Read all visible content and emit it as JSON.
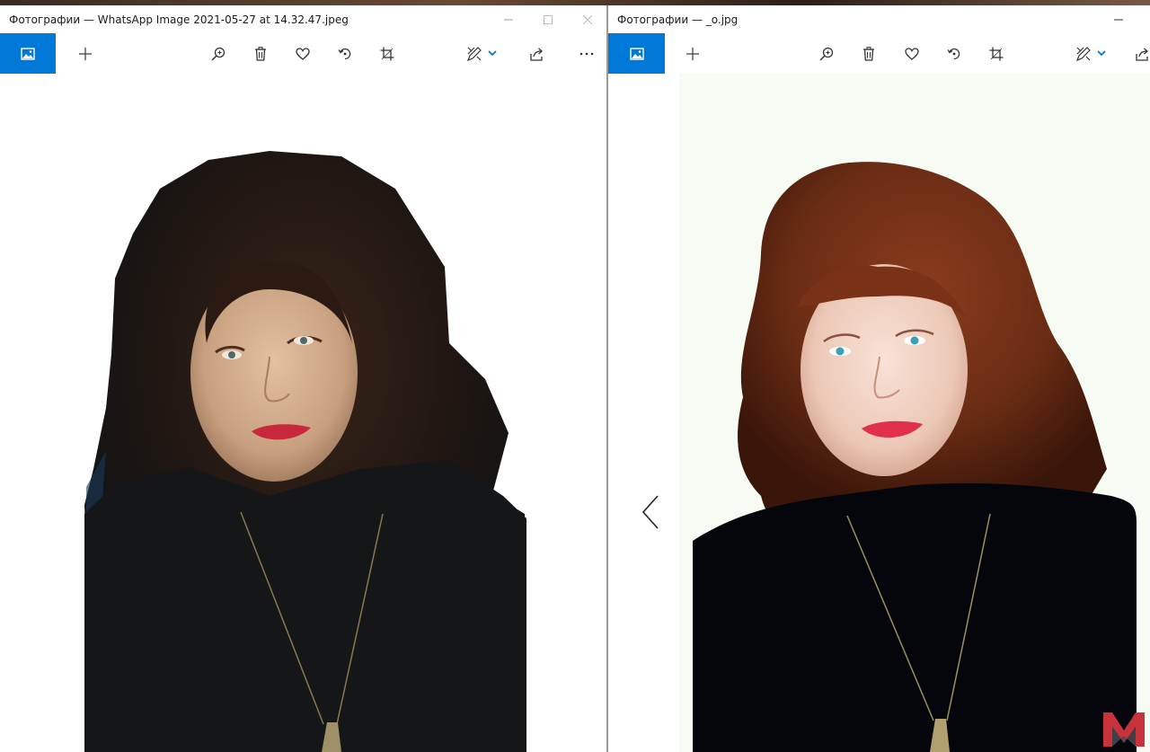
{
  "colors": {
    "accent": "#0078d7",
    "window_bg": "#ffffff",
    "icon": "#333333",
    "caption": "#999999",
    "logo_red": "#c8323c",
    "logo_gray": "#4a4a52"
  },
  "left_window": {
    "title": "Фотографии — WhatsApp Image 2021-05-27 at 14.32.47.jpeg",
    "caption_buttons": [
      "minimize",
      "maximize",
      "close"
    ],
    "toolbar_icons": [
      "gallery-icon",
      "add-icon",
      "zoom-icon",
      "delete-icon",
      "heart-icon",
      "rotate-icon",
      "crop-icon",
      "edit-draw-icon",
      "chevron-down-icon",
      "share-icon",
      "more-icon"
    ],
    "photo": {
      "description_colors": {
        "hair": "#1e1612",
        "sweater": "#141618",
        "face": "#d2ab8a",
        "lips": "#c8283c"
      }
    }
  },
  "right_window": {
    "title": "Фотографии — _o.jpg",
    "caption_buttons": [
      "minimize"
    ],
    "toolbar_icons": [
      "gallery-icon",
      "add-icon",
      "zoom-icon",
      "delete-icon",
      "heart-icon",
      "rotate-icon",
      "crop-icon",
      "edit-draw-icon",
      "chevron-down-icon",
      "share-icon"
    ],
    "nav": {
      "previous_icon": "chevron-left-icon"
    },
    "photo": {
      "description_colors": {
        "hair": "#6a2c14",
        "sweater": "#04060c",
        "face": "#f0d0c0",
        "lips": "#e0304a"
      }
    }
  },
  "watermark": {
    "icon": "m-logo-icon"
  }
}
